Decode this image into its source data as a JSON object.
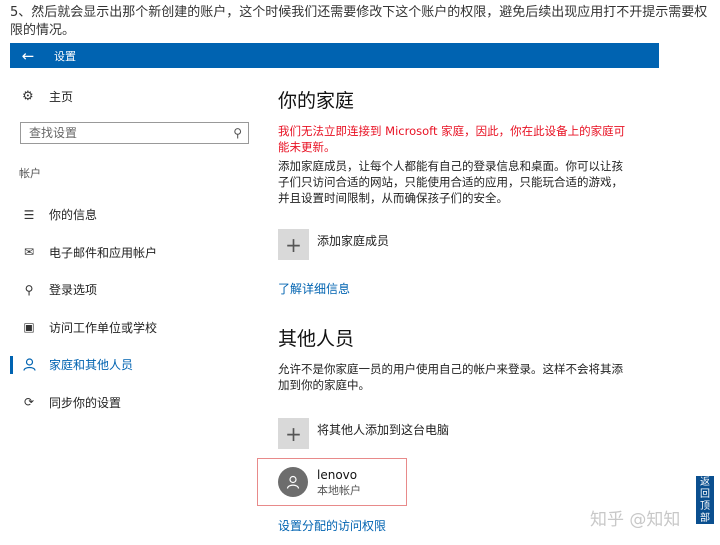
{
  "article": {
    "text": "5、然后就会显示出那个新创建的账户，这个时候我们还需要修改下这个账户的权限，避免后续出现应用打不开提示需要权限的情况。"
  },
  "titlebar": {
    "title": "设置"
  },
  "sidebar": {
    "home_label": "主页",
    "search_placeholder": "查找设置",
    "section_label": "帐户",
    "items": [
      {
        "label": "你的信息",
        "icon": "person-info-icon"
      },
      {
        "label": "电子邮件和应用帐户",
        "icon": "mail-icon"
      },
      {
        "label": "登录选项",
        "icon": "key-icon"
      },
      {
        "label": "访问工作单位或学校",
        "icon": "briefcase-icon"
      },
      {
        "label": "家庭和其他人员",
        "icon": "person-icon",
        "active": true
      },
      {
        "label": "同步你的设置",
        "icon": "sync-icon"
      }
    ]
  },
  "main": {
    "family_title": "你的家庭",
    "family_warning": "我们无法立即连接到 Microsoft 家庭，因此，你在此设备上的家庭可能未更新。",
    "family_desc": "添加家庭成员，让每个人都能有自己的登录信息和桌面。你可以让孩子们只访问合适的网站，只能使用合适的应用，只能玩合适的游戏，并且设置时间限制，从而确保孩子们的安全。",
    "add_family_label": "添加家庭成员",
    "learn_more": "了解详细信息",
    "others_title": "其他人员",
    "others_desc": "允许不是你家庭一员的用户使用自己的帐户来登录。这样不会将其添加到你的家庭中。",
    "add_other_label": "将其他人添加到这台电脑",
    "account": {
      "name": "lenovo",
      "type": "本地帐户"
    },
    "assigned_access": "设置分配的访问权限"
  },
  "overlay": {
    "watermark": "知乎 @知知",
    "back_to_top": "返回顶部"
  },
  "colors": {
    "accent": "#0063b1",
    "warning": "#e81123",
    "highlight_border": "#e88a8a"
  }
}
